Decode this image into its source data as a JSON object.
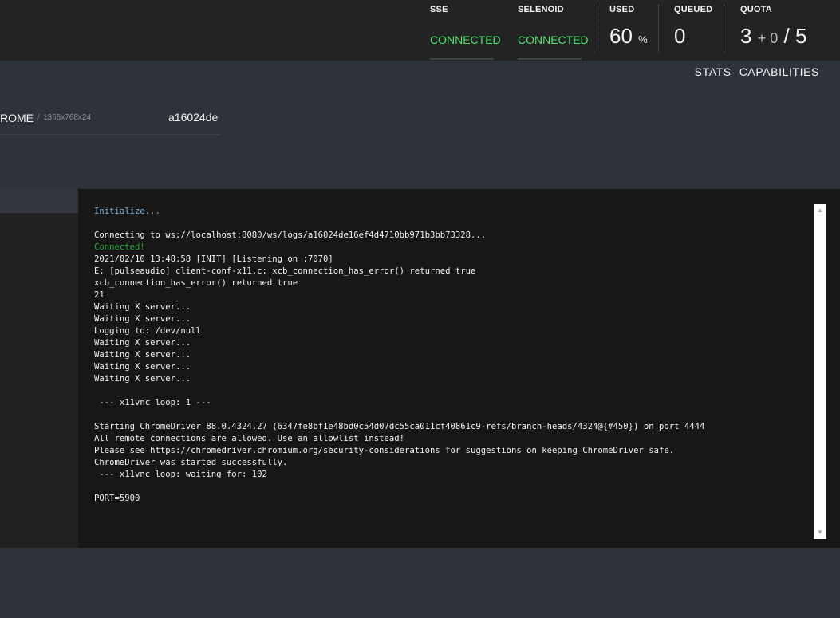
{
  "header": {
    "sse": {
      "label": "SSE",
      "status": "CONNECTED"
    },
    "selenoid": {
      "label": "SELENOID",
      "status": "CONNECTED"
    },
    "used": {
      "label": "USED",
      "value": "60",
      "unit": "%"
    },
    "queued": {
      "label": "QUEUED",
      "value": "0"
    },
    "quota": {
      "label": "QUOTA",
      "used": "3",
      "pending": "+ 0",
      "separator": "/",
      "total": "5"
    },
    "colors": {
      "connected": "#4ee26a",
      "background": "#232323"
    }
  },
  "tabs": [
    {
      "label": "STATS"
    },
    {
      "label": "CAPABILITIES"
    }
  ],
  "session": {
    "browser": "ROME",
    "separator": "/",
    "resolution": "1366x768x24",
    "id": "a16024de"
  },
  "log": {
    "lines": [
      {
        "text": "Initialize...",
        "kind": "info"
      },
      {
        "text": "",
        "kind": "plain"
      },
      {
        "text": "Connecting to ws://localhost:8080/ws/logs/a16024de16ef4d4710bb971b3bb73328...",
        "kind": "plain"
      },
      {
        "text": "Connected!",
        "kind": "ok"
      },
      {
        "text": "2021/02/10 13:48:58 [INIT] [Listening on :7070]",
        "kind": "plain"
      },
      {
        "text": "E: [pulseaudio] client-conf-x11.c: xcb_connection_has_error() returned true",
        "kind": "plain"
      },
      {
        "text": "xcb_connection_has_error() returned true",
        "kind": "plain"
      },
      {
        "text": "21",
        "kind": "plain"
      },
      {
        "text": "Waiting X server...",
        "kind": "plain"
      },
      {
        "text": "Waiting X server...",
        "kind": "plain"
      },
      {
        "text": "Logging to: /dev/null",
        "kind": "plain"
      },
      {
        "text": "Waiting X server...",
        "kind": "plain"
      },
      {
        "text": "Waiting X server...",
        "kind": "plain"
      },
      {
        "text": "Waiting X server...",
        "kind": "plain"
      },
      {
        "text": "Waiting X server...",
        "kind": "plain"
      },
      {
        "text": "",
        "kind": "plain"
      },
      {
        "text": " --- x11vnc loop: 1 ---",
        "kind": "plain"
      },
      {
        "text": "",
        "kind": "plain"
      },
      {
        "text": "Starting ChromeDriver 88.0.4324.27 (6347fe8bf1e48bd0c54d07dc55ca011cf40861c9-refs/branch-heads/4324@{#450}) on port 4444",
        "kind": "plain"
      },
      {
        "text": "All remote connections are allowed. Use an allowlist instead!",
        "kind": "plain"
      },
      {
        "text": "Please see https://chromedriver.chromium.org/security-considerations for suggestions on keeping ChromeDriver safe.",
        "kind": "plain"
      },
      {
        "text": "ChromeDriver was started successfully.",
        "kind": "plain"
      },
      {
        "text": " --- x11vnc loop: waiting for: 102",
        "kind": "plain"
      },
      {
        "text": "",
        "kind": "plain"
      },
      {
        "text": "PORT=5900",
        "kind": "plain"
      }
    ]
  },
  "scrollbar": {
    "up_icon": "caret-up-icon",
    "down_icon": "caret-down-icon"
  }
}
